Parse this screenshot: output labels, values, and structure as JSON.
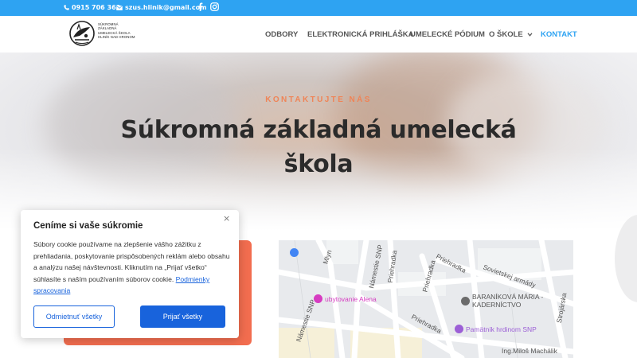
{
  "topbar": {
    "phone": "0915 706 363",
    "email": "szus.hlinik@gmail.com",
    "icons": [
      "phone-icon",
      "mail-icon",
      "facebook-icon",
      "instagram-icon"
    ],
    "color": "#2ea3f2"
  },
  "logo": {
    "lines": [
      "SÚKROMNÁ",
      "ZÁKLADNÁ",
      "UMELECKÁ ŠKOLA",
      "HLINÍK NAD HRONOM"
    ]
  },
  "nav": {
    "items": [
      {
        "label": "ODBORY"
      },
      {
        "label": "ELEKTRONICKÁ PRIHLÁŠKA"
      },
      {
        "label": "UMELECKÉ PÓDIUM"
      },
      {
        "label": "O ŠKOLE"
      },
      {
        "label": "KONTAKT",
        "active": true
      }
    ],
    "active_color": "#2ea3f2"
  },
  "hero": {
    "kicker": "KONTAKTUJTE NÁS",
    "title_line1": "Súkromná základná umelecká",
    "title_line2": "škola",
    "kicker_color": "#ef8457"
  },
  "map": {
    "streets": [
      "Mlyn",
      "Námestie SNP",
      "Priehradka",
      "Priehradka",
      "Priehradka",
      "Sovietskej armády",
      "Námestie SNP",
      "Priehradka",
      "Strojárska"
    ],
    "pois": [
      {
        "label": "ubytovanie Alena",
        "color": "#d63cc1"
      },
      {
        "label": "BARANÍKOVÁ MÁRIA - KADERNÍCTVO",
        "color": "#6b6b6b"
      },
      {
        "label": "Pamätník hrdinom SNP",
        "color": "#9c5fd6"
      },
      {
        "label": "Ing.Miloš Machálik",
        "color": "#6b6b6b"
      }
    ]
  },
  "cookie": {
    "title": "Ceníme si vaše súkromie",
    "close": "×",
    "body": "Súbory cookie používame na zlepšenie vášho zážitku z prehliadania, poskytovanie prispôsobených reklám alebo obsahu a analýzu našej návštevnosti. Kliknutím na „Prijať všetko“ súhlasíte s naším používaním súborov cookie.",
    "link": "Podmienky spracovania",
    "reject_label": "Odmietnuť všetky",
    "accept_label": "Prijať všetky",
    "accent": "#1863dc"
  },
  "accents": {
    "orange_card": "#f26d4f"
  }
}
